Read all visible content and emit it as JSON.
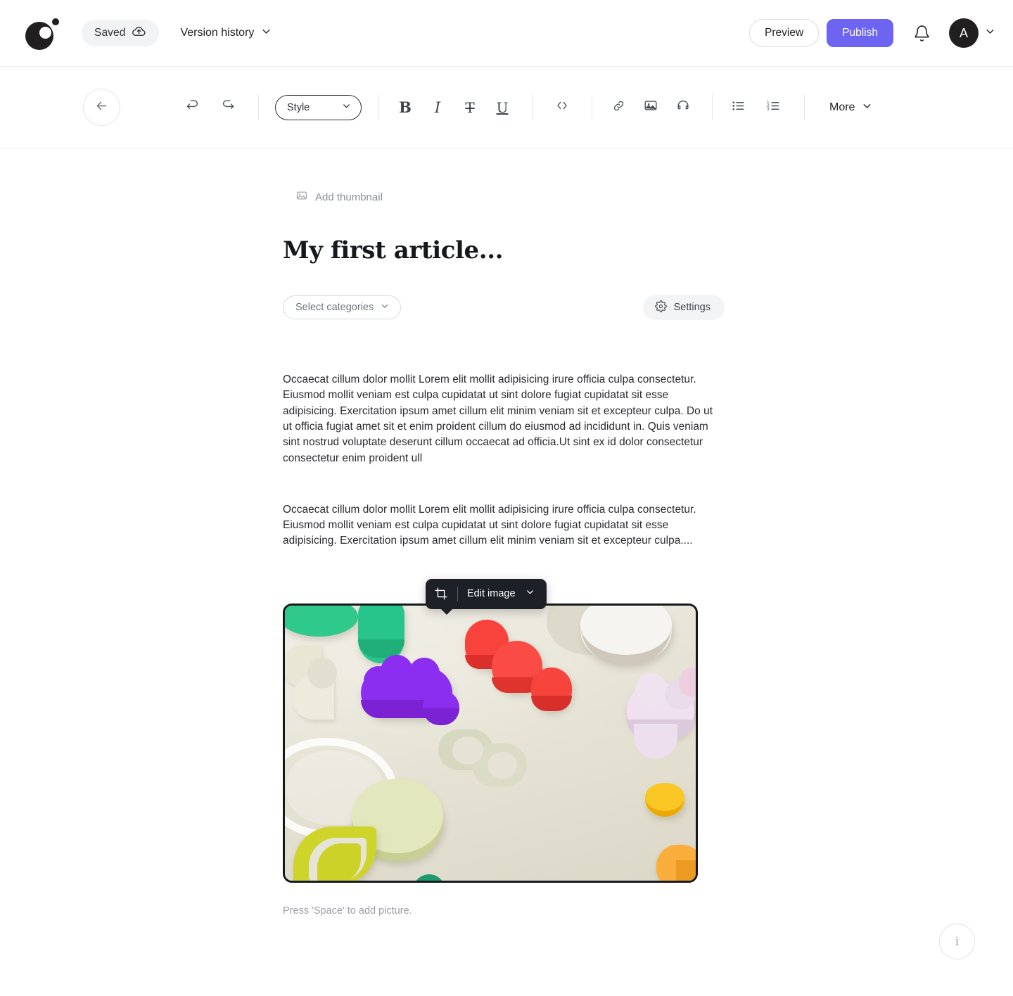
{
  "topbar": {
    "logo_icon": "brand-logo-circle",
    "save_status": "Saved",
    "save_icon": "cloud-upload-icon",
    "version_history": "Version history",
    "version_chevron_icon": "chevron-down-icon",
    "preview_label": "Preview",
    "publish_label": "Publish",
    "notifications_icon": "bell-icon",
    "avatar_initial": "A",
    "avatar_chevron_icon": "chevron-down-icon"
  },
  "toolbar": {
    "back_icon": "arrow-left-icon",
    "undo_icon": "undo-icon",
    "redo_icon": "redo-icon",
    "style_label": "Style",
    "style_chevron_icon": "chevron-down-icon",
    "bold_icon": "bold-icon",
    "italic_icon": "italic-icon",
    "strikethrough_icon": "strikethrough-icon",
    "underline_icon": "underline-icon",
    "code_icon": "code-icon",
    "link_icon": "link-icon",
    "image_icon": "image-icon",
    "audio_icon": "headphones-icon",
    "bulleted_list_icon": "bulleted-list-icon",
    "numbered_list_icon": "numbered-list-icon",
    "more_label": "More",
    "more_chevron_icon": "chevron-down-icon"
  },
  "document": {
    "add_thumbnail_label": "Add thumbnail",
    "add_thumbnail_icon": "image-placeholder-icon",
    "title": "My first article...",
    "categories_label": "Select categories",
    "categories_chevron_icon": "chevron-down-icon",
    "settings_label": "Settings",
    "settings_icon": "gear-icon",
    "paragraph_1": "Occaecat cillum dolor mollit Lorem elit mollit adipisicing irure officia culpa consectetur. Eiusmod mollit veniam est culpa cupidatat ut sint dolore fugiat cupidatat sit esse adipisicing. Exercitation ipsum amet cillum elit minim veniam sit et excepteur culpa. Do ut ut officia fugiat amet sit et enim proident cillum do eiusmod ad incididunt in. Quis veniam sint nostrud voluptate deserunt cillum occaecat ad officia.Ut sint ex id dolor consectetur consectetur enim proident ull",
    "paragraph_2": "Occaecat cillum dolor mollit Lorem elit mollit adipisicing irure officia culpa consectetur. Eiusmod mollit veniam est culpa cupidatat ut sint dolore fugiat cupidatat sit esse adipisicing. Exercitation ipsum amet cillum elit minim veniam sit et excepteur culpa....",
    "image_caption": "Press 'Space' to add picture.",
    "image_alt": "Colorful 3D foam shapes on a beige tray"
  },
  "image_popover": {
    "crop_icon": "crop-icon",
    "edit_image_label": "Edit image",
    "chevron_icon": "chevron-down-icon"
  },
  "floating": {
    "info_label": "i",
    "info_icon": "info-icon"
  },
  "colors": {
    "accent_publish": "#6d64f2",
    "text_primary": "#1d1f23",
    "text_muted": "#8a8f96",
    "border": "#eceef0",
    "image_border": "#15181c",
    "popover_bg": "#1d2026"
  }
}
